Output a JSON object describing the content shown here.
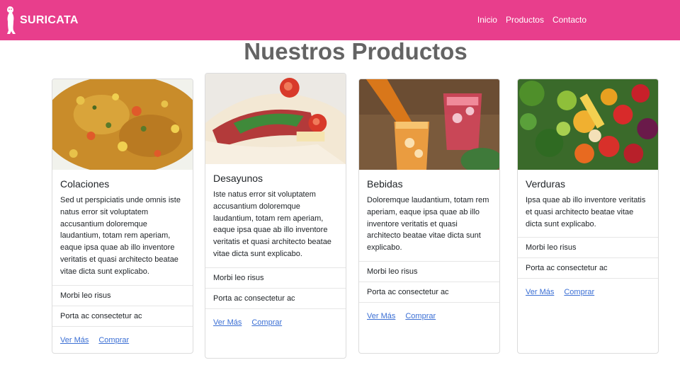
{
  "navbar": {
    "brand": "SURICATA",
    "links": [
      "Inicio",
      "Productos",
      "Contacto"
    ]
  },
  "page_title": "Nuestros Productos",
  "cards": [
    {
      "title": "Colaciones",
      "text": "Sed ut perspiciatis unde omnis iste natus error sit voluptatem accusantium doloremque laudantium, totam rem aperiam, eaque ipsa quae ab illo inventore veritatis et quasi architecto beatae vitae dicta sunt explicabo.",
      "items": [
        "Morbi leo risus",
        "Porta ac consectetur ac"
      ],
      "link1": "Ver Más",
      "link2": "Comprar"
    },
    {
      "title": "Desayunos",
      "text": "Iste natus error sit voluptatem accusantium doloremque laudantium, totam rem aperiam, eaque ipsa quae ab illo inventore veritatis et quasi architecto beatae vitae dicta sunt explicabo.",
      "items": [
        "Morbi leo risus",
        "Porta ac consectetur ac"
      ],
      "link1": "Ver Más",
      "link2": "Comprar"
    },
    {
      "title": "Bebidas",
      "text": "Doloremque laudantium, totam rem aperiam, eaque ipsa quae ab illo inventore veritatis et quasi architecto beatae vitae dicta sunt explicabo.",
      "items": [
        "Morbi leo risus",
        "Porta ac consectetur ac"
      ],
      "link1": "Ver Más",
      "link2": "Comprar"
    },
    {
      "title": "Verduras",
      "text": "Ipsa quae ab illo inventore veritatis et quasi architecto beatae vitae dicta sunt explicabo.",
      "items": [
        "Morbi leo risus",
        "Porta ac consectetur ac"
      ],
      "link1": "Ver Más",
      "link2": "Comprar"
    }
  ],
  "colors": {
    "navbar": "#e83e8c",
    "title": "#646464",
    "link": "#3b6fd4"
  }
}
